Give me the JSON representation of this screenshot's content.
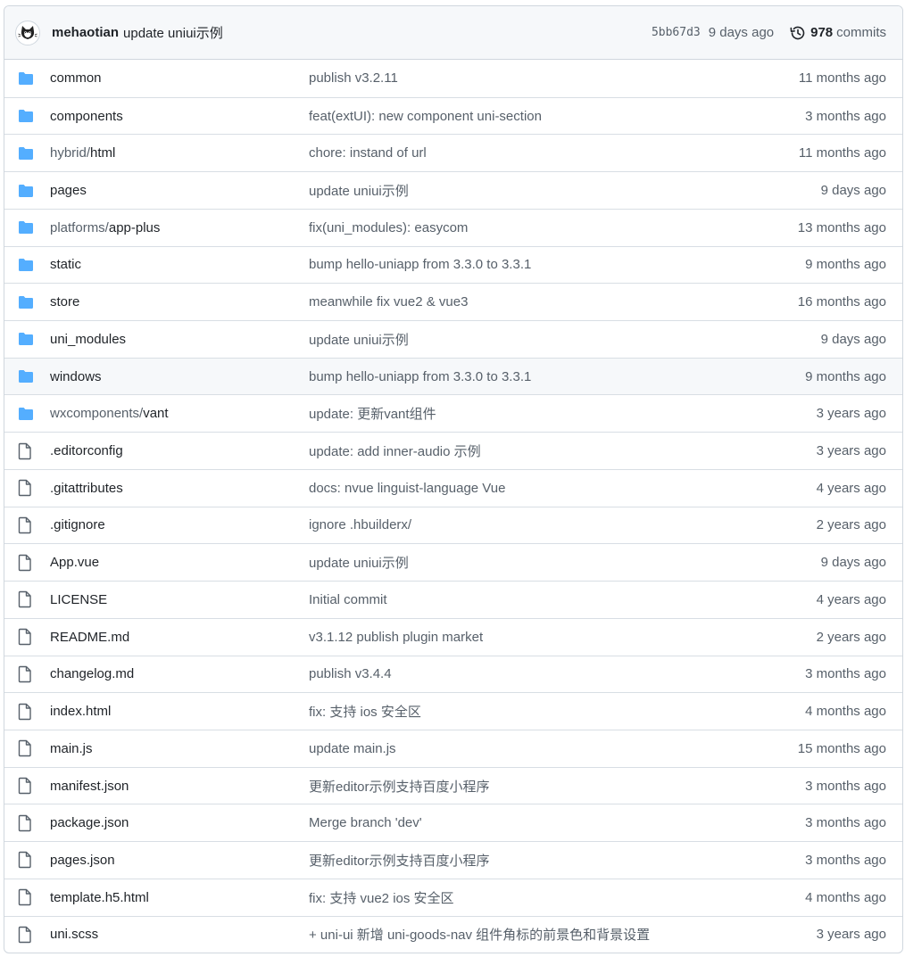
{
  "latest_commit": {
    "author": "mehaotian",
    "message": "update uniui示例",
    "sha": "5bb67d3",
    "time_ago": "9 days ago",
    "commit_count": "978",
    "commits_label": "commits",
    "history_icon": "history-clock-icon",
    "avatar": "cat-avatar"
  },
  "colors": {
    "folder": "#54aeff",
    "file": "#57606a",
    "border": "#d0d7de",
    "header_bg": "#f6f8fa"
  },
  "files": [
    {
      "type": "dir",
      "prefix": "",
      "name": "common",
      "message": "publish v3.2.11",
      "age": "11 months ago"
    },
    {
      "type": "dir",
      "prefix": "",
      "name": "components",
      "message": "feat(extUI): new component uni-section",
      "age": "3 months ago"
    },
    {
      "type": "dir",
      "prefix": "hybrid/",
      "name": "html",
      "message": "chore: instand of url",
      "age": "11 months ago"
    },
    {
      "type": "dir",
      "prefix": "",
      "name": "pages",
      "message": "update uniui示例",
      "age": "9 days ago"
    },
    {
      "type": "dir",
      "prefix": "platforms/",
      "name": "app-plus",
      "message": "fix(uni_modules): easycom",
      "age": "13 months ago"
    },
    {
      "type": "dir",
      "prefix": "",
      "name": "static",
      "message": "bump hello-uniapp from 3.3.0 to 3.3.1",
      "age": "9 months ago"
    },
    {
      "type": "dir",
      "prefix": "",
      "name": "store",
      "message": "meanwhile fix vue2 & vue3",
      "age": "16 months ago"
    },
    {
      "type": "dir",
      "prefix": "",
      "name": "uni_modules",
      "message": "update uniui示例",
      "age": "9 days ago"
    },
    {
      "type": "dir",
      "prefix": "",
      "name": "windows",
      "message": "bump hello-uniapp from 3.3.0 to 3.3.1",
      "age": "9 months ago"
    },
    {
      "type": "dir",
      "prefix": "wxcomponents/",
      "name": "vant",
      "message": "update: 更新vant组件",
      "age": "3 years ago"
    },
    {
      "type": "file",
      "prefix": "",
      "name": ".editorconfig",
      "message": "update: add inner-audio 示例",
      "age": "3 years ago"
    },
    {
      "type": "file",
      "prefix": "",
      "name": ".gitattributes",
      "message": "docs: nvue linguist-language Vue",
      "age": "4 years ago"
    },
    {
      "type": "file",
      "prefix": "",
      "name": ".gitignore",
      "message": "ignore .hbuilderx/",
      "age": "2 years ago"
    },
    {
      "type": "file",
      "prefix": "",
      "name": "App.vue",
      "message": "update uniui示例",
      "age": "9 days ago"
    },
    {
      "type": "file",
      "prefix": "",
      "name": "LICENSE",
      "message": "Initial commit",
      "age": "4 years ago"
    },
    {
      "type": "file",
      "prefix": "",
      "name": "README.md",
      "message": "v3.1.12 publish plugin market",
      "age": "2 years ago"
    },
    {
      "type": "file",
      "prefix": "",
      "name": "changelog.md",
      "message": "publish v3.4.4",
      "age": "3 months ago"
    },
    {
      "type": "file",
      "prefix": "",
      "name": "index.html",
      "message": "fix: 支持 ios 安全区",
      "age": "4 months ago"
    },
    {
      "type": "file",
      "prefix": "",
      "name": "main.js",
      "message": "update main.js",
      "age": "15 months ago"
    },
    {
      "type": "file",
      "prefix": "",
      "name": "manifest.json",
      "message": "更新editor示例支持百度小程序",
      "age": "3 months ago"
    },
    {
      "type": "file",
      "prefix": "",
      "name": "package.json",
      "message": "Merge branch 'dev'",
      "age": "3 months ago"
    },
    {
      "type": "file",
      "prefix": "",
      "name": "pages.json",
      "message": "更新editor示例支持百度小程序",
      "age": "3 months ago"
    },
    {
      "type": "file",
      "prefix": "",
      "name": "template.h5.html",
      "message": "fix: 支持 vue2 ios 安全区",
      "age": "4 months ago"
    },
    {
      "type": "file",
      "prefix": "",
      "name": "uni.scss",
      "message": "+ uni-ui 新增 uni-goods-nav 组件角标的前景色和背景设置",
      "age": "3 years ago"
    }
  ]
}
